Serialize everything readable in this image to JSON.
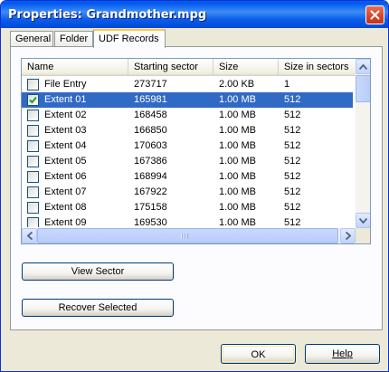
{
  "window": {
    "title": "Properties: Grandmother.mpg"
  },
  "tabs": [
    {
      "label": "General"
    },
    {
      "label": "Folder"
    },
    {
      "label": "UDF Records",
      "active": true
    }
  ],
  "list": {
    "columns": [
      "Name",
      "Starting sector",
      "Size",
      "Size in sectors"
    ],
    "rows": [
      {
        "checked": false,
        "name": "File Entry",
        "sector": "273717",
        "size": "2.00 KB",
        "sectors": "1"
      },
      {
        "checked": true,
        "name": "Extent 01",
        "sector": "165981",
        "size": "1.00 MB",
        "sectors": "512",
        "selected": true
      },
      {
        "checked": false,
        "name": "Extent 02",
        "sector": "168458",
        "size": "1.00 MB",
        "sectors": "512"
      },
      {
        "checked": false,
        "name": "Extent 03",
        "sector": "166850",
        "size": "1.00 MB",
        "sectors": "512"
      },
      {
        "checked": false,
        "name": "Extent 04",
        "sector": "170603",
        "size": "1.00 MB",
        "sectors": "512"
      },
      {
        "checked": false,
        "name": "Extent 05",
        "sector": "167386",
        "size": "1.00 MB",
        "sectors": "512"
      },
      {
        "checked": false,
        "name": "Extent 06",
        "sector": "168994",
        "size": "1.00 MB",
        "sectors": "512"
      },
      {
        "checked": false,
        "name": "Extent 07",
        "sector": "167922",
        "size": "1.00 MB",
        "sectors": "512"
      },
      {
        "checked": false,
        "name": "Extent 08",
        "sector": "175158",
        "size": "1.00 MB",
        "sectors": "512"
      },
      {
        "checked": false,
        "name": "Extent 09",
        "sector": "169530",
        "size": "1.00 MB",
        "sectors": "512"
      }
    ]
  },
  "buttons": {
    "view_sector": "View Sector",
    "recover_selected": "Recover Selected",
    "ok": "OK",
    "help": "Help"
  },
  "colors": {
    "title_bar": "#0a5be8",
    "selection": "#316ac5",
    "close_button": "#d5452a",
    "active_tab_accent": "#ffc83c"
  }
}
